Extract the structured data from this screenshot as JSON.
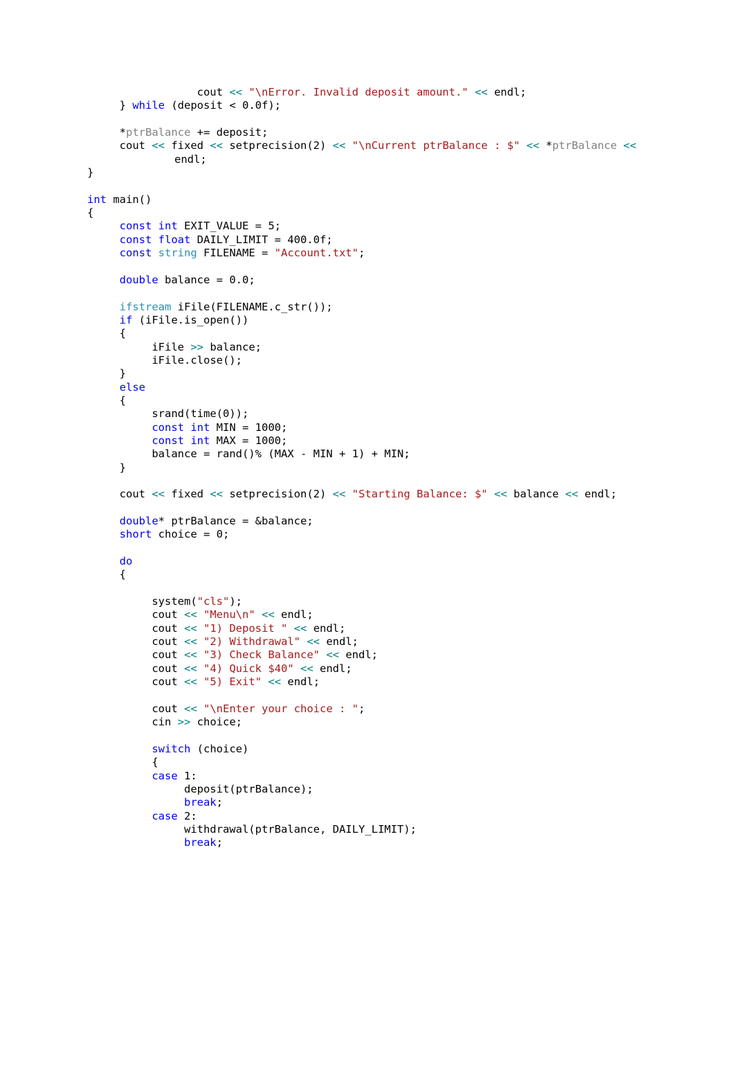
{
  "document": {
    "kind": "source-code-listing",
    "language": "C++",
    "page_background": "#ffffff"
  },
  "colors": {
    "plain": "#000000",
    "keyword_blue": "#0000ee",
    "type_teal": "#2b91af",
    "string_red": "#a81b1b",
    "stream_operator_teal": "#008080",
    "dim_identifier_gray": "#808080"
  },
  "code": {
    "lines": [
      [
        {
          "t": "                 cout ",
          "c": "pl"
        },
        {
          "t": "<<",
          "c": "op"
        },
        {
          "t": " ",
          "c": "pl"
        },
        {
          "t": "\"\\nError. Invalid deposit amount.\"",
          "c": "str"
        },
        {
          "t": " ",
          "c": "pl"
        },
        {
          "t": "<<",
          "c": "op"
        },
        {
          "t": " endl;",
          "c": "pl"
        }
      ],
      [
        {
          "t": "     } ",
          "c": "pl"
        },
        {
          "t": "while",
          "c": "kw"
        },
        {
          "t": " (deposit < 0.0f);",
          "c": "pl"
        }
      ],
      [],
      [
        {
          "t": "     *",
          "c": "pl"
        },
        {
          "t": "ptrBalance",
          "c": "id"
        },
        {
          "t": " += deposit;",
          "c": "pl"
        }
      ],
      [
        {
          "t": "     cout ",
          "c": "pl"
        },
        {
          "t": "<<",
          "c": "op"
        },
        {
          "t": " fixed ",
          "c": "pl"
        },
        {
          "t": "<<",
          "c": "op"
        },
        {
          "t": " setprecision(2) ",
          "c": "pl"
        },
        {
          "t": "<<",
          "c": "op"
        },
        {
          "t": " ",
          "c": "pl"
        },
        {
          "t": "\"\\nCurrent ptrBalance : $\"",
          "c": "str"
        },
        {
          "t": " ",
          "c": "pl"
        },
        {
          "t": "<<",
          "c": "op"
        },
        {
          "t": " *",
          "c": "pl"
        },
        {
          "t": "ptrBalance",
          "c": "id"
        },
        {
          "t": " ",
          "c": "pl"
        },
        {
          "t": "<<",
          "c": "op"
        },
        {
          "t": " endl;",
          "c": "pl"
        }
      ],
      [
        {
          "t": "}",
          "c": "pl"
        }
      ],
      [],
      [
        {
          "t": "int",
          "c": "kw"
        },
        {
          "t": " main()",
          "c": "pl"
        }
      ],
      [
        {
          "t": "{",
          "c": "pl"
        }
      ],
      [
        {
          "t": "     ",
          "c": "pl"
        },
        {
          "t": "const int",
          "c": "kw"
        },
        {
          "t": " EXIT_VALUE = 5;",
          "c": "pl"
        }
      ],
      [
        {
          "t": "     ",
          "c": "pl"
        },
        {
          "t": "const float",
          "c": "kw"
        },
        {
          "t": " DAILY_LIMIT = 400.0f;",
          "c": "pl"
        }
      ],
      [
        {
          "t": "     ",
          "c": "pl"
        },
        {
          "t": "const ",
          "c": "kw"
        },
        {
          "t": "string",
          "c": "typ"
        },
        {
          "t": " FILENAME = ",
          "c": "pl"
        },
        {
          "t": "\"Account.txt\"",
          "c": "str"
        },
        {
          "t": ";",
          "c": "pl"
        }
      ],
      [],
      [
        {
          "t": "     ",
          "c": "pl"
        },
        {
          "t": "double",
          "c": "kw"
        },
        {
          "t": " balance = 0.0;",
          "c": "pl"
        }
      ],
      [],
      [
        {
          "t": "     ",
          "c": "pl"
        },
        {
          "t": "ifstream",
          "c": "typ"
        },
        {
          "t": " iFile(FILENAME.c_str());",
          "c": "pl"
        }
      ],
      [
        {
          "t": "     ",
          "c": "pl"
        },
        {
          "t": "if",
          "c": "kw"
        },
        {
          "t": " (iFile.is_open())",
          "c": "pl"
        }
      ],
      [
        {
          "t": "     {",
          "c": "pl"
        }
      ],
      [
        {
          "t": "          iFile ",
          "c": "pl"
        },
        {
          "t": ">>",
          "c": "op"
        },
        {
          "t": " balance;",
          "c": "pl"
        }
      ],
      [
        {
          "t": "          iFile.close();",
          "c": "pl"
        }
      ],
      [
        {
          "t": "     }",
          "c": "pl"
        }
      ],
      [
        {
          "t": "     ",
          "c": "pl"
        },
        {
          "t": "else",
          "c": "kw"
        }
      ],
      [
        {
          "t": "     {",
          "c": "pl"
        }
      ],
      [
        {
          "t": "          srand(time(0));",
          "c": "pl"
        }
      ],
      [
        {
          "t": "          ",
          "c": "pl"
        },
        {
          "t": "const int",
          "c": "kw"
        },
        {
          "t": " MIN = 1000;",
          "c": "pl"
        }
      ],
      [
        {
          "t": "          ",
          "c": "pl"
        },
        {
          "t": "const int",
          "c": "kw"
        },
        {
          "t": " MAX = 1000;",
          "c": "pl"
        }
      ],
      [
        {
          "t": "          balance = rand()% (MAX - MIN + 1) + MIN;",
          "c": "pl"
        }
      ],
      [
        {
          "t": "     }",
          "c": "pl"
        }
      ],
      [],
      [
        {
          "t": "     cout ",
          "c": "pl"
        },
        {
          "t": "<<",
          "c": "op"
        },
        {
          "t": " fixed ",
          "c": "pl"
        },
        {
          "t": "<<",
          "c": "op"
        },
        {
          "t": " setprecision(2) ",
          "c": "pl"
        },
        {
          "t": "<<",
          "c": "op"
        },
        {
          "t": " ",
          "c": "pl"
        },
        {
          "t": "\"Starting Balance: $\"",
          "c": "str"
        },
        {
          "t": " ",
          "c": "pl"
        },
        {
          "t": "<<",
          "c": "op"
        },
        {
          "t": " balance ",
          "c": "pl"
        },
        {
          "t": "<<",
          "c": "op"
        },
        {
          "t": " endl;",
          "c": "pl"
        }
      ],
      [],
      [
        {
          "t": "     ",
          "c": "pl"
        },
        {
          "t": "double",
          "c": "kw"
        },
        {
          "t": "* ptrBalance = &balance;",
          "c": "pl"
        }
      ],
      [
        {
          "t": "     ",
          "c": "pl"
        },
        {
          "t": "short",
          "c": "kw"
        },
        {
          "t": " choice = 0;",
          "c": "pl"
        }
      ],
      [],
      [
        {
          "t": "     ",
          "c": "pl"
        },
        {
          "t": "do",
          "c": "kw"
        }
      ],
      [
        {
          "t": "     {",
          "c": "pl"
        }
      ],
      [],
      [
        {
          "t": "          system(",
          "c": "pl"
        },
        {
          "t": "\"cls\"",
          "c": "str"
        },
        {
          "t": ");",
          "c": "pl"
        }
      ],
      [
        {
          "t": "          cout ",
          "c": "pl"
        },
        {
          "t": "<<",
          "c": "op"
        },
        {
          "t": " ",
          "c": "pl"
        },
        {
          "t": "\"Menu\\n\"",
          "c": "str"
        },
        {
          "t": " ",
          "c": "pl"
        },
        {
          "t": "<<",
          "c": "op"
        },
        {
          "t": " endl;",
          "c": "pl"
        }
      ],
      [
        {
          "t": "          cout ",
          "c": "pl"
        },
        {
          "t": "<<",
          "c": "op"
        },
        {
          "t": " ",
          "c": "pl"
        },
        {
          "t": "\"1) Deposit \"",
          "c": "str"
        },
        {
          "t": " ",
          "c": "pl"
        },
        {
          "t": "<<",
          "c": "op"
        },
        {
          "t": " endl;",
          "c": "pl"
        }
      ],
      [
        {
          "t": "          cout ",
          "c": "pl"
        },
        {
          "t": "<<",
          "c": "op"
        },
        {
          "t": " ",
          "c": "pl"
        },
        {
          "t": "\"2) Withdrawal\"",
          "c": "str"
        },
        {
          "t": " ",
          "c": "pl"
        },
        {
          "t": "<<",
          "c": "op"
        },
        {
          "t": " endl;",
          "c": "pl"
        }
      ],
      [
        {
          "t": "          cout ",
          "c": "pl"
        },
        {
          "t": "<<",
          "c": "op"
        },
        {
          "t": " ",
          "c": "pl"
        },
        {
          "t": "\"3) Check Balance\"",
          "c": "str"
        },
        {
          "t": " ",
          "c": "pl"
        },
        {
          "t": "<<",
          "c": "op"
        },
        {
          "t": " endl;",
          "c": "pl"
        }
      ],
      [
        {
          "t": "          cout ",
          "c": "pl"
        },
        {
          "t": "<<",
          "c": "op"
        },
        {
          "t": " ",
          "c": "pl"
        },
        {
          "t": "\"4) Quick $40\"",
          "c": "str"
        },
        {
          "t": " ",
          "c": "pl"
        },
        {
          "t": "<<",
          "c": "op"
        },
        {
          "t": " endl;",
          "c": "pl"
        }
      ],
      [
        {
          "t": "          cout ",
          "c": "pl"
        },
        {
          "t": "<<",
          "c": "op"
        },
        {
          "t": " ",
          "c": "pl"
        },
        {
          "t": "\"5) Exit\"",
          "c": "str"
        },
        {
          "t": " ",
          "c": "pl"
        },
        {
          "t": "<<",
          "c": "op"
        },
        {
          "t": " endl;",
          "c": "pl"
        }
      ],
      [],
      [
        {
          "t": "          cout ",
          "c": "pl"
        },
        {
          "t": "<<",
          "c": "op"
        },
        {
          "t": " ",
          "c": "pl"
        },
        {
          "t": "\"\\nEnter your choice : \"",
          "c": "str"
        },
        {
          "t": ";",
          "c": "pl"
        }
      ],
      [
        {
          "t": "          cin ",
          "c": "pl"
        },
        {
          "t": ">>",
          "c": "op"
        },
        {
          "t": " choice;",
          "c": "pl"
        }
      ],
      [],
      [
        {
          "t": "          ",
          "c": "pl"
        },
        {
          "t": "switch",
          "c": "kw"
        },
        {
          "t": " (choice)",
          "c": "pl"
        }
      ],
      [
        {
          "t": "          {",
          "c": "pl"
        }
      ],
      [
        {
          "t": "          ",
          "c": "pl"
        },
        {
          "t": "case",
          "c": "kw"
        },
        {
          "t": " 1:",
          "c": "pl"
        }
      ],
      [
        {
          "t": "               deposit(ptrBalance);",
          "c": "pl"
        }
      ],
      [
        {
          "t": "               ",
          "c": "pl"
        },
        {
          "t": "break",
          "c": "kw"
        },
        {
          "t": ";",
          "c": "pl"
        }
      ],
      [
        {
          "t": "          ",
          "c": "pl"
        },
        {
          "t": "case",
          "c": "kw"
        },
        {
          "t": " 2:",
          "c": "pl"
        }
      ],
      [
        {
          "t": "               withdrawal(ptrBalance, DAILY_LIMIT);",
          "c": "pl"
        }
      ],
      [
        {
          "t": "               ",
          "c": "pl"
        },
        {
          "t": "break",
          "c": "kw"
        },
        {
          "t": ";",
          "c": "pl"
        }
      ]
    ]
  }
}
